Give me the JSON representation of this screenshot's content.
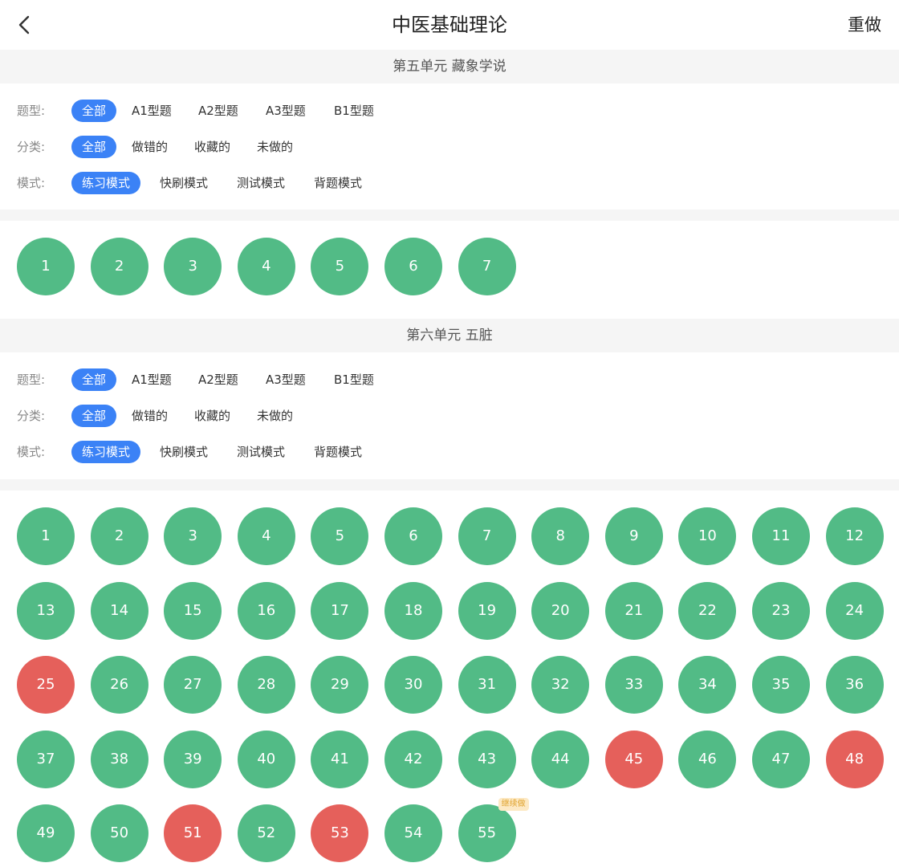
{
  "nav": {
    "title": "中医基础理论",
    "redo": "重做"
  },
  "filter_labels": {
    "type": "题型:",
    "category": "分类:",
    "mode": "模式:"
  },
  "units": [
    {
      "title": "第五单元 藏象学说",
      "types": [
        "全部",
        "A1型题",
        "A2型题",
        "A3型题",
        "B1型题"
      ],
      "categories": [
        "全部",
        "做错的",
        "收藏的",
        "未做的"
      ],
      "modes": [
        "练习模式",
        "快刷模式",
        "测试模式",
        "背题模式"
      ],
      "questions": [
        {
          "n": "1",
          "status": "done"
        },
        {
          "n": "2",
          "status": "done"
        },
        {
          "n": "3",
          "status": "done"
        },
        {
          "n": "4",
          "status": "done"
        },
        {
          "n": "5",
          "status": "done"
        },
        {
          "n": "6",
          "status": "done"
        },
        {
          "n": "7",
          "status": "done"
        }
      ]
    },
    {
      "title": "第六单元 五脏",
      "types": [
        "全部",
        "A1型题",
        "A2型题",
        "A3型题",
        "B1型题"
      ],
      "categories": [
        "全部",
        "做错的",
        "收藏的",
        "未做的"
      ],
      "modes": [
        "练习模式",
        "快刷模式",
        "测试模式",
        "背题模式"
      ],
      "resume_tag": "继续做",
      "questions": [
        {
          "n": "1",
          "status": "done"
        },
        {
          "n": "2",
          "status": "done"
        },
        {
          "n": "3",
          "status": "done"
        },
        {
          "n": "4",
          "status": "done"
        },
        {
          "n": "5",
          "status": "done"
        },
        {
          "n": "6",
          "status": "done"
        },
        {
          "n": "7",
          "status": "done"
        },
        {
          "n": "8",
          "status": "done"
        },
        {
          "n": "9",
          "status": "done"
        },
        {
          "n": "10",
          "status": "done"
        },
        {
          "n": "11",
          "status": "done"
        },
        {
          "n": "12",
          "status": "done"
        },
        {
          "n": "13",
          "status": "done"
        },
        {
          "n": "14",
          "status": "done"
        },
        {
          "n": "15",
          "status": "done"
        },
        {
          "n": "16",
          "status": "done"
        },
        {
          "n": "17",
          "status": "done"
        },
        {
          "n": "18",
          "status": "done"
        },
        {
          "n": "19",
          "status": "done"
        },
        {
          "n": "20",
          "status": "done"
        },
        {
          "n": "21",
          "status": "done"
        },
        {
          "n": "22",
          "status": "done"
        },
        {
          "n": "23",
          "status": "done"
        },
        {
          "n": "24",
          "status": "done"
        },
        {
          "n": "25",
          "status": "wrong"
        },
        {
          "n": "26",
          "status": "done"
        },
        {
          "n": "27",
          "status": "done"
        },
        {
          "n": "28",
          "status": "done"
        },
        {
          "n": "29",
          "status": "done"
        },
        {
          "n": "30",
          "status": "done"
        },
        {
          "n": "31",
          "status": "done"
        },
        {
          "n": "32",
          "status": "done"
        },
        {
          "n": "33",
          "status": "done"
        },
        {
          "n": "34",
          "status": "done"
        },
        {
          "n": "35",
          "status": "done"
        },
        {
          "n": "36",
          "status": "done"
        },
        {
          "n": "37",
          "status": "done"
        },
        {
          "n": "38",
          "status": "done"
        },
        {
          "n": "39",
          "status": "done"
        },
        {
          "n": "40",
          "status": "done"
        },
        {
          "n": "41",
          "status": "done"
        },
        {
          "n": "42",
          "status": "done"
        },
        {
          "n": "43",
          "status": "done"
        },
        {
          "n": "44",
          "status": "done"
        },
        {
          "n": "45",
          "status": "wrong"
        },
        {
          "n": "46",
          "status": "done"
        },
        {
          "n": "47",
          "status": "done"
        },
        {
          "n": "48",
          "status": "wrong"
        },
        {
          "n": "49",
          "status": "done"
        },
        {
          "n": "50",
          "status": "done"
        },
        {
          "n": "51",
          "status": "wrong"
        },
        {
          "n": "52",
          "status": "done"
        },
        {
          "n": "53",
          "status": "wrong"
        },
        {
          "n": "54",
          "status": "done"
        },
        {
          "n": "55",
          "status": "done",
          "resume": true
        }
      ]
    }
  ],
  "colors": {
    "done": "#52bb86",
    "wrong": "#e5605b",
    "accent": "#3b82f6"
  }
}
